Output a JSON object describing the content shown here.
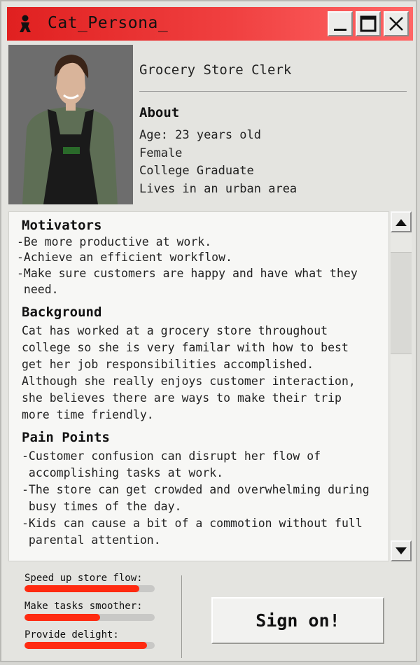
{
  "window": {
    "title": "Cat_Persona_",
    "controls": {
      "minimize": "minimize-icon",
      "maximize": "maximize-icon",
      "close": "close-icon"
    },
    "accent": "#e02020"
  },
  "profile": {
    "role": "Grocery Store Clerk",
    "about_heading": "About",
    "about": [
      "Age: 23 years old",
      "Female",
      "College Graduate",
      "Lives in an urban area"
    ]
  },
  "content": {
    "motivators_heading": "Motivators",
    "motivators": [
      "-Be more productive at work.",
      "-Achieve an efficient workflow.",
      "-Make sure customers are happy and have what they",
      " need."
    ],
    "background_heading": "Background",
    "background": [
      "Cat has worked at a grocery store throughout",
      "college so she is very familar with how to best",
      "get her job responsibilities accomplished.",
      "Although she really enjoys customer interaction,",
      "she believes there are ways to make their trip",
      "more time friendly."
    ],
    "pain_heading": "Pain Points",
    "pain_points": [
      "-Customer confusion can disrupt her flow of",
      " accomplishing tasks at work.",
      "-The store can get crowded and overwhelming during",
      " busy times of the day.",
      "-Kids can cause a bit of a commotion without full",
      " parental attention."
    ]
  },
  "goals": [
    {
      "label": "Speed up store flow:",
      "progress": 0.88
    },
    {
      "label": "Make tasks smoother:",
      "progress": 0.58
    },
    {
      "label": "Provide delight:",
      "progress": 0.94
    }
  ],
  "goal_color": "#ff2a10",
  "actions": {
    "sign_on": "Sign on!"
  }
}
